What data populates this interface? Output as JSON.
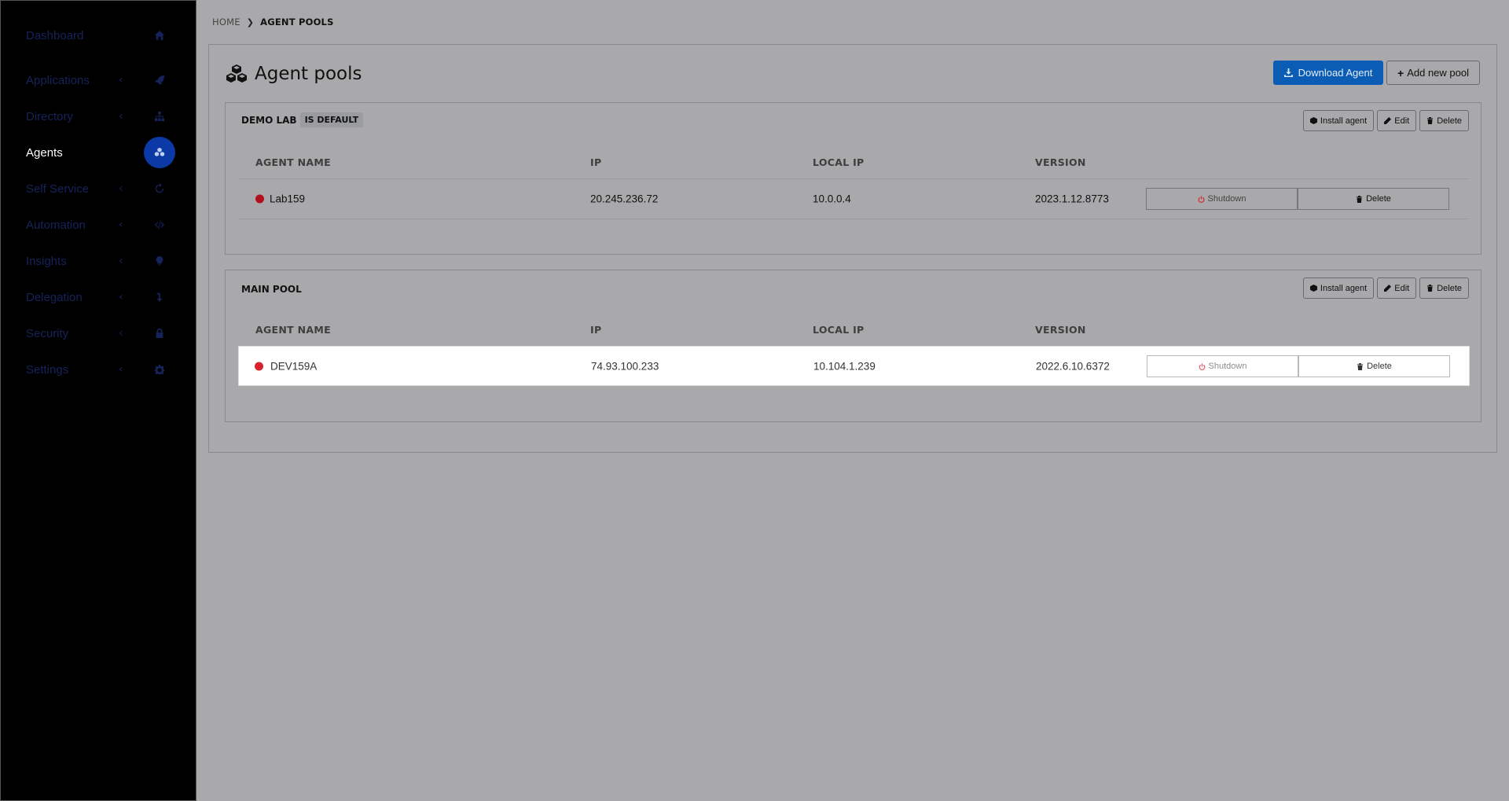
{
  "sidebar": {
    "items": [
      {
        "label": "Dashboard",
        "icon": "home-icon",
        "chevron": "",
        "active": false
      },
      {
        "label": "Applications",
        "icon": "rocket-icon",
        "chevron": "‹",
        "active": false
      },
      {
        "label": "Directory",
        "icon": "sitemap-icon",
        "chevron": "‹",
        "active": false
      },
      {
        "label": "Agents",
        "icon": "agents-icon",
        "chevron": "",
        "active": true
      },
      {
        "label": "Self Service",
        "icon": "refresh-icon",
        "chevron": "‹",
        "active": false
      },
      {
        "label": "Automation",
        "icon": "code-icon",
        "chevron": "‹",
        "active": false
      },
      {
        "label": "Insights",
        "icon": "lightbulb-icon",
        "chevron": "‹",
        "active": false
      },
      {
        "label": "Delegation",
        "icon": "level-down-icon",
        "chevron": "‹",
        "active": false
      },
      {
        "label": "Security",
        "icon": "lock-icon",
        "chevron": "‹",
        "active": false
      },
      {
        "label": "Settings",
        "icon": "gear-icon",
        "chevron": "‹",
        "active": false
      }
    ]
  },
  "breadcrumb": {
    "home": "HOME",
    "current": "AGENT POOLS"
  },
  "page": {
    "title": "Agent pools",
    "download_label": "Download Agent",
    "add_pool_label": "Add new pool"
  },
  "pool_actions": {
    "install": "Install agent",
    "edit": "Edit",
    "delete": "Delete"
  },
  "table_headers": {
    "name": "AGENT NAME",
    "ip": "IP",
    "local_ip": "LOCAL IP",
    "version": "VERSION"
  },
  "row_actions": {
    "shutdown": "Shutdown",
    "delete": "Delete"
  },
  "pools": [
    {
      "name": "DEMO LAB",
      "badge": "IS DEFAULT",
      "agents": [
        {
          "name": "Lab159",
          "ip": "20.245.236.72",
          "local_ip": "10.0.0.4",
          "version": "2023.1.12.8773",
          "status_color": "#b20f1c"
        }
      ]
    },
    {
      "name": "MAIN POOL",
      "badge": "",
      "agents": [
        {
          "name": "DEV159A",
          "ip": "74.93.100.233",
          "local_ip": "10.104.1.239",
          "version": "2022.6.10.6372",
          "status_color": "#d8232f"
        }
      ]
    }
  ],
  "colors": {
    "accent": "#0a5cb4",
    "sidebar_bg": "#000000",
    "active_icon_bg": "#0b3aa6",
    "status_offline": "#d8232f"
  }
}
